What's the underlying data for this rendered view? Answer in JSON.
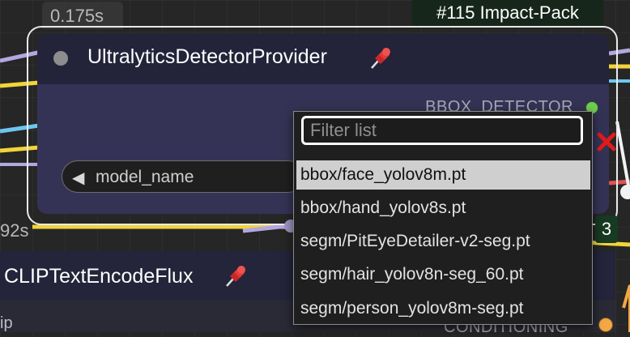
{
  "timings": {
    "top": "0.175s",
    "left": "92s"
  },
  "pack_badge": "#115 Impact-Pack",
  "node": {
    "title": "UltralyticsDetectorProvider",
    "output_label": "BBOX_DETECTOR",
    "widget_label": "model_name",
    "widget_arrow": "◀"
  },
  "node2": {
    "title": "CLIPTextEncodeFlux",
    "input_label": "ip",
    "output_label": "CONDITIONING"
  },
  "side_badge": "3",
  "dropdown": {
    "placeholder": "Filter list",
    "items": [
      "bbox/face_yolov8m.pt",
      "bbox/hand_yolov8s.pt",
      "segm/PitEyeDetailer-v2-seg.pt",
      "segm/hair_yolov8n-seg_60.pt",
      "segm/person_yolov8m-seg.pt"
    ],
    "selected_index": 0
  },
  "colors": {
    "canvas": "#262626",
    "node_body": "#353355",
    "node_header": "#23233a",
    "output_ok": "#6fcf4f",
    "conditioning": "#f3a844",
    "wire_yellow": "#f2d43a",
    "wire_purple": "#b4a7e0",
    "wire_blue": "#6cc7f0",
    "wire_red": "#e05252"
  },
  "icons": [
    "pin-icon",
    "close-icon",
    "arrow-left-icon"
  ]
}
